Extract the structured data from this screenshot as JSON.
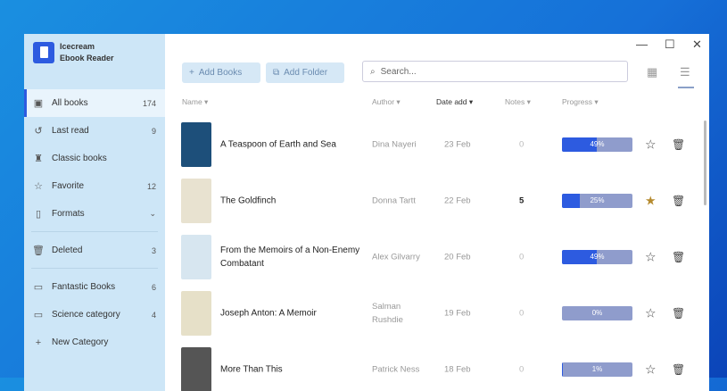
{
  "app": {
    "name_line1": "Icecream",
    "name_line2": "Ebook Reader"
  },
  "sidebar": {
    "items": [
      {
        "label": "All books",
        "count": "174",
        "icon": "books-icon"
      },
      {
        "label": "Last read",
        "count": "9",
        "icon": "history-icon"
      },
      {
        "label": "Classic books",
        "count": "",
        "icon": "classic-icon"
      },
      {
        "label": "Favorite",
        "count": "12",
        "icon": "star-icon"
      },
      {
        "label": "Formats",
        "count": "",
        "icon": "file-icon"
      },
      {
        "label": "Deleted",
        "count": "3",
        "icon": "trash-icon"
      },
      {
        "label": "Fantastic Books",
        "count": "6",
        "icon": "folder-icon"
      },
      {
        "label": "Science category",
        "count": "4",
        "icon": "folder-icon"
      },
      {
        "label": "New Category",
        "count": "",
        "icon": "plus-icon"
      }
    ],
    "formats_chevron": "⌄"
  },
  "toolbar": {
    "add_books": "Add Books",
    "add_folder": "Add Folder",
    "search_placeholder": "Search..."
  },
  "columns": {
    "name": "Name",
    "author": "Author",
    "date": "Date add",
    "notes": "Notes",
    "progress": "Progress"
  },
  "books": [
    {
      "title": "A Teaspoon of Earth and Sea",
      "author": "Dina Nayeri",
      "date": "23 Feb",
      "notes": "0",
      "progress": 49,
      "progress_label": "49%",
      "favorite": false,
      "cover": "#1d4f7a"
    },
    {
      "title": "The Goldfinch",
      "author": "Donna Tartt",
      "date": "22 Feb",
      "notes": "5",
      "progress": 25,
      "progress_label": "25%",
      "favorite": true,
      "cover": "#e8e2d0"
    },
    {
      "title": "From the Memoirs of a Non-Enemy Combatant",
      "author": "Alex Gilvarry",
      "date": "20 Feb",
      "notes": "0",
      "progress": 49,
      "progress_label": "49%",
      "favorite": false,
      "cover": "#d7e6f0"
    },
    {
      "title": "Joseph Anton: A Memoir",
      "author": "Salman Rushdie",
      "date": "19 Feb",
      "notes": "0",
      "progress": 0,
      "progress_label": "0%",
      "favorite": false,
      "cover": "#e6e0c8"
    },
    {
      "title": "More Than This",
      "author": "Patrick Ness",
      "date": "18 Feb",
      "notes": "0",
      "progress": 1,
      "progress_label": "1%",
      "favorite": false,
      "cover": "#555"
    }
  ],
  "colors": {
    "accent": "#2d5be0",
    "sidebar": "#cde6f7",
    "favorite": "#b58a2e"
  }
}
